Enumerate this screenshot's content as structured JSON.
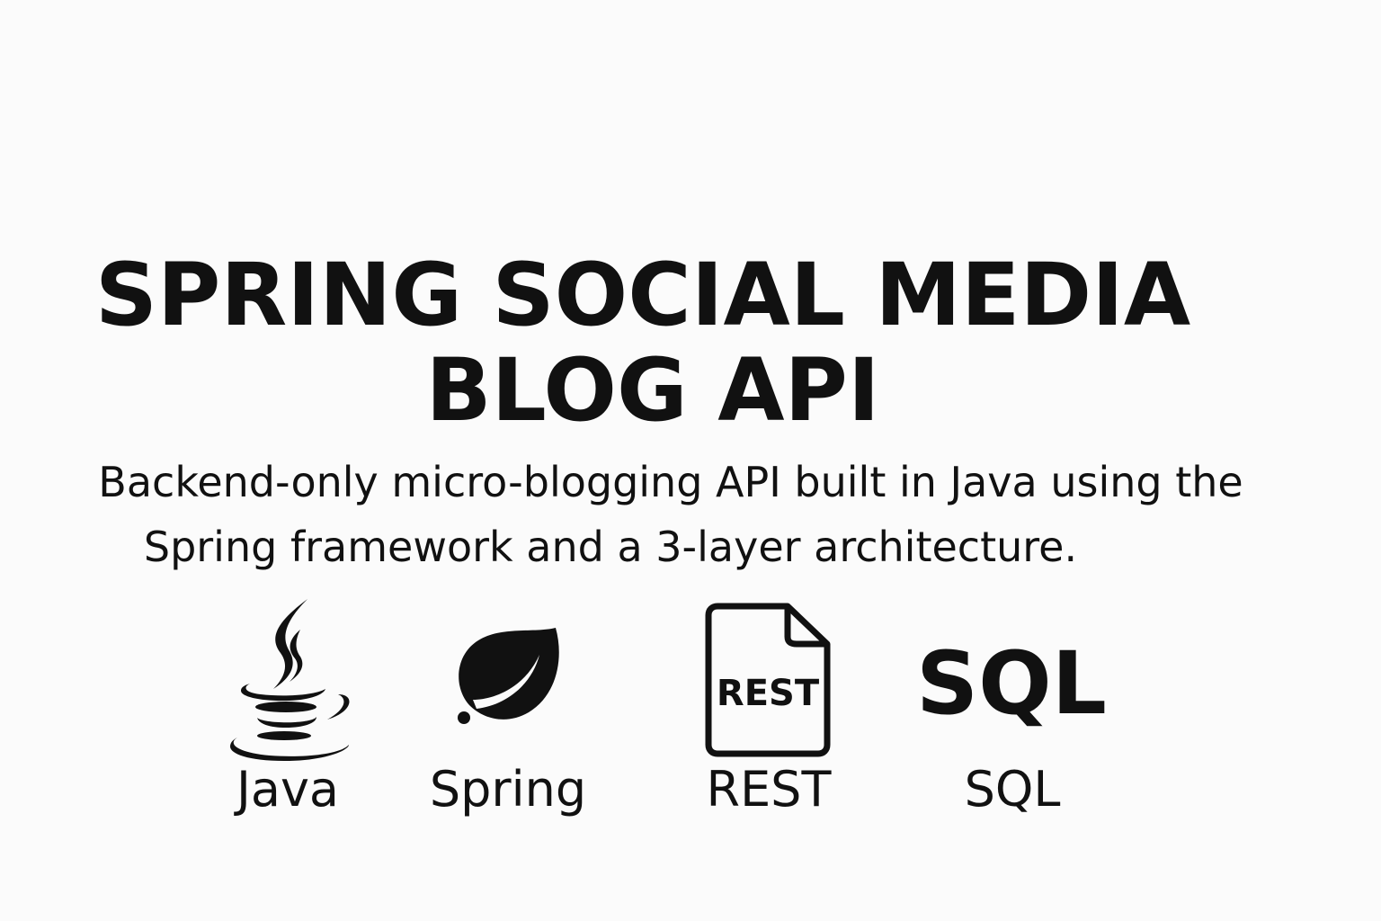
{
  "title": {
    "line1": "SPRING SOCIAL MEDIA",
    "line2": "BLOG API"
  },
  "subtitle": {
    "line1": "Backend-only micro-blogging API built in Java using the",
    "line2": "Spring framework and a 3-layer architecture."
  },
  "tech": {
    "java": {
      "icon": "java-icon",
      "label": "Java"
    },
    "spring": {
      "icon": "spring-leaf-icon",
      "label": "Spring"
    },
    "rest": {
      "icon": "rest-document-icon",
      "mark": "REST",
      "label": "REST"
    },
    "sql": {
      "icon": "sql-icon",
      "mark": "SQL",
      "label": "SQL"
    }
  },
  "colors": {
    "background": "#fbfbfb",
    "foreground": "#111111"
  }
}
